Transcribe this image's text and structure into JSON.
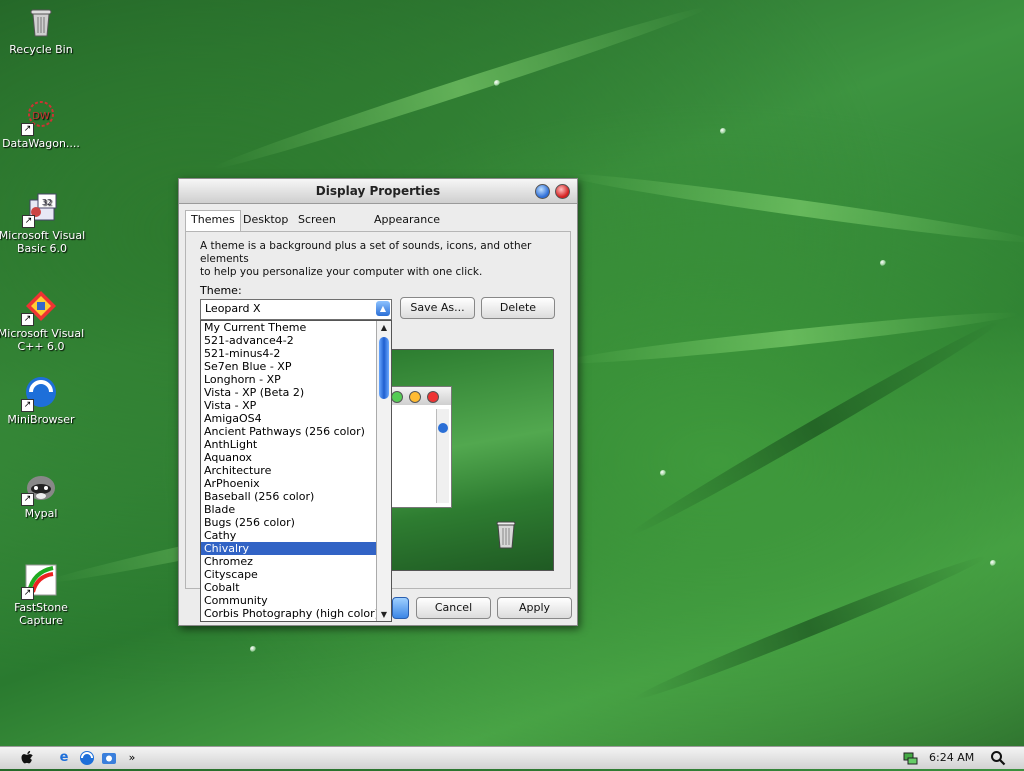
{
  "desktop": {
    "icons": [
      {
        "label": "Recycle Bin",
        "icon": "recycle-bin-icon"
      },
      {
        "label": "DataWagon....",
        "icon": "datawagon-icon"
      },
      {
        "label": "Microsoft Visual Basic 6.0",
        "icon": "visual-basic-icon"
      },
      {
        "label": "Microsoft Visual C++ 6.0",
        "icon": "visual-cpp-icon"
      },
      {
        "label": "MiniBrowser",
        "icon": "minibrowser-icon"
      },
      {
        "label": "Mypal",
        "icon": "mypal-icon"
      },
      {
        "label": "FastStone Capture",
        "icon": "faststone-icon"
      }
    ]
  },
  "dialog": {
    "title": "Display Properties",
    "tabs": [
      {
        "label": "Themes",
        "active": true
      },
      {
        "label": "Desktop",
        "active": false
      },
      {
        "label": "Screen Saver",
        "active": false
      },
      {
        "label": "Appearance",
        "active": false
      }
    ],
    "description_line1": "A theme is a background plus a set of sounds, icons, and other elements",
    "description_line2": "to help you personalize your computer with one click.",
    "theme_label": "Theme:",
    "theme_selected": "Leopard X",
    "save_as_label": "Save As...",
    "delete_label": "Delete",
    "ok_label": "",
    "cancel_label": "Cancel",
    "apply_label": "Apply",
    "theme_options": [
      "My Current Theme",
      "521-advance4-2",
      "521-minus4-2",
      "Se7en Blue - XP",
      "Longhorn - XP",
      "Vista - XP (Beta 2)",
      "Vista - XP",
      "AmigaOS4",
      "Ancient Pathways (256 color)",
      "AnthLight",
      "Aquanox",
      "Architecture",
      "ArPhoenix",
      "Baseball (256 color)",
      "Blade",
      "Bugs (256 color)",
      "Cathy",
      "Chivalry",
      "Chromez",
      "Cityscape",
      "Cobalt",
      "Community",
      "Corbis Photography (high color)"
    ],
    "highlighted_option": "Chivalry"
  },
  "taskbar": {
    "clock": "6:24 AM",
    "chevron": "»"
  },
  "colors": {
    "selection": "#3163c5",
    "close_button": "#d42020",
    "help_button": "#2f6fd8"
  }
}
